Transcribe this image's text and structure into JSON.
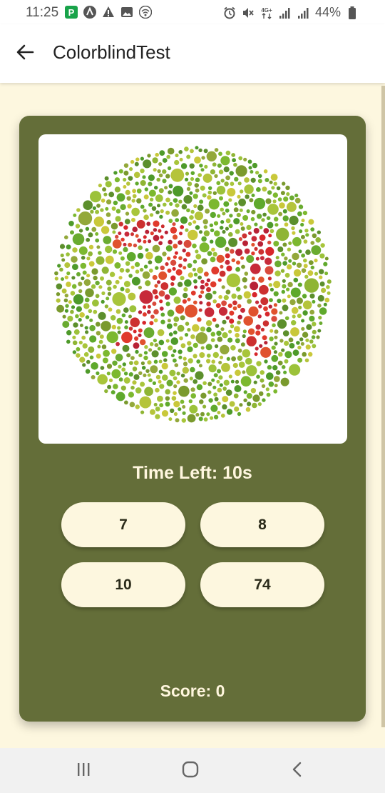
{
  "status_bar": {
    "time": "11:25",
    "battery_text": "44%",
    "left_icons": [
      "parking-app-icon",
      "notification-a-icon",
      "warning-icon",
      "image-icon",
      "wifi-icon"
    ],
    "right_icons": [
      "alarm-icon",
      "mute-icon",
      "network-4g-icon",
      "signal-icon",
      "signal-icon",
      "battery-icon"
    ]
  },
  "app_bar": {
    "title": "ColorblindTest",
    "back_icon": "arrow-left-icon"
  },
  "test": {
    "plate_image": "color-blindness-dot-plate",
    "timer_text": "Time Left: 10s",
    "options": [
      "7",
      "8",
      "10",
      "74"
    ],
    "score_text": "Score: 0"
  },
  "nav_bar": {
    "icons": [
      "recent-apps-icon",
      "home-icon",
      "back-icon"
    ]
  },
  "colors": {
    "card": "#646e39",
    "background": "#fdf7df",
    "button": "#fdf7df",
    "text_light": "#fff6de"
  }
}
